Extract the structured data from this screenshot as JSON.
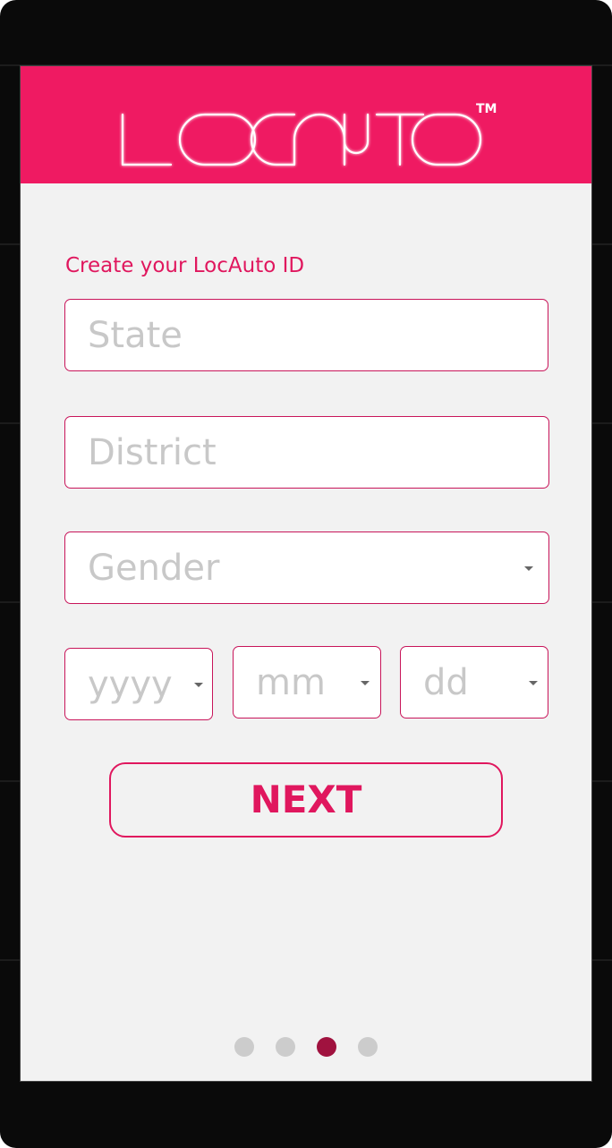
{
  "app": {
    "brand": "LOCAUTO",
    "trademark": "TM",
    "brand_color": "#ef1a62"
  },
  "form": {
    "subtitle": "Create your LocAuto ID",
    "state_placeholder": "State",
    "district_placeholder": "District",
    "gender_placeholder": "Gender",
    "year_placeholder": "yyyy",
    "month_placeholder": "mm",
    "day_placeholder": "dd",
    "next_label": "NEXT"
  },
  "pager": {
    "total": 4,
    "active_index": 2,
    "active_color": "#a0123f",
    "inactive_color": "#cccccc"
  }
}
